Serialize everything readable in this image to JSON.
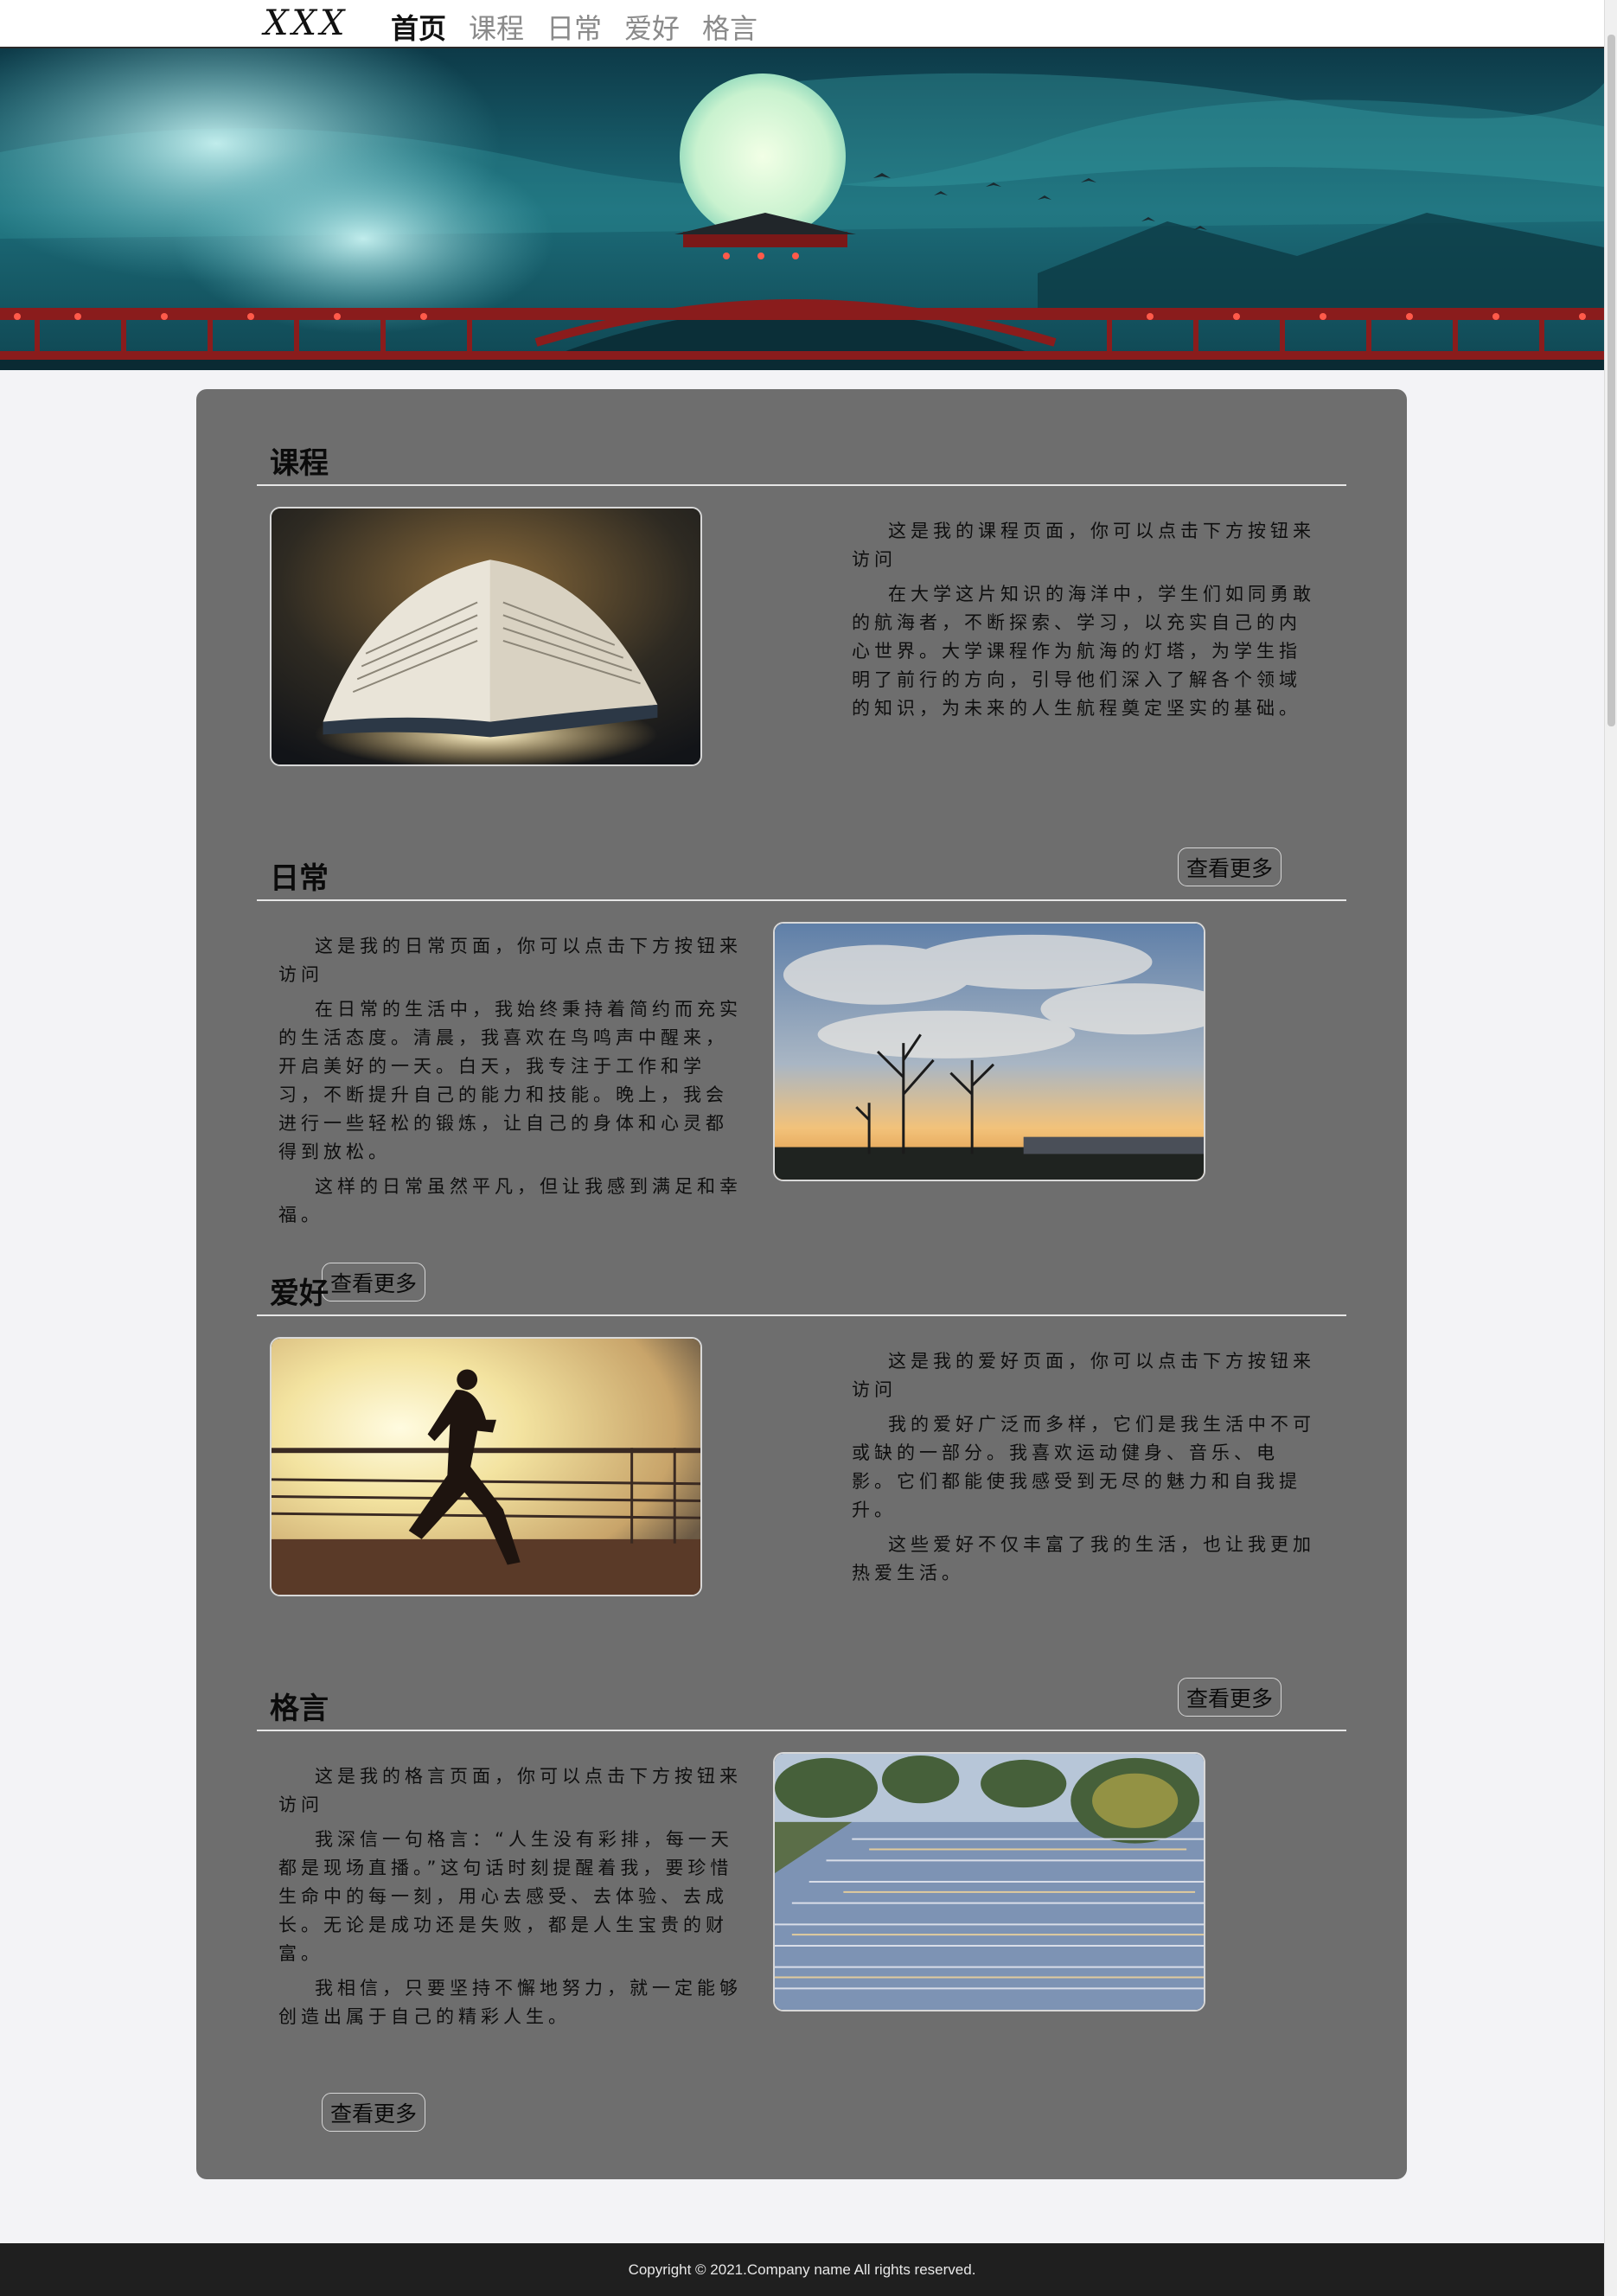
{
  "nav": {
    "logo": "XXX",
    "links": [
      "首页",
      "课程",
      "日常",
      "爱好",
      "格言"
    ],
    "active_index": 0
  },
  "sections": [
    {
      "title": "课程",
      "image": "open-book-photo",
      "paragraphs": [
        "这是我的课程页面，你可以点击下方按钮来访问",
        "在大学这片知识的海洋中，学生们如同勇敢的航海者，不断探索、学习，以充实自己的内心世界。大学课程作为航海的灯塔，为学生指明了前行的方向，引导他们深入了解各个领域的知识，为未来的人生航程奠定坚实的基础。"
      ],
      "button": "查看更多"
    },
    {
      "title": "日常",
      "image": "sunset-sky-photo",
      "paragraphs": [
        "这是我的日常页面，你可以点击下方按钮来访问",
        "在日常的生活中，我始终秉持着简约而充实的生活态度。清晨，我喜欢在鸟鸣声中醒来，开启美好的一天。白天，我专注于工作和学习，不断提升自己的能力和技能。晚上，我会进行一些轻松的锻炼，让自己的身体和心灵都得到放松。",
        "这样的日常虽然平凡，但让我感到满足和幸福。"
      ],
      "button": "查看更多"
    },
    {
      "title": "爱好",
      "image": "runner-sunrise-photo",
      "paragraphs": [
        "这是我的爱好页面，你可以点击下方按钮来访问",
        "我的爱好广泛而多样，它们是我生活中不可或缺的一部分。我喜欢运动健身、音乐、电影。它们都能使我感受到无尽的魅力和自我提升。",
        "这些爱好不仅丰富了我的生活，也让我更加热爱生活。"
      ],
      "button": "查看更多"
    },
    {
      "title": "格言",
      "image": "lit-stairs-photo",
      "paragraphs": [
        "这是我的格言页面，你可以点击下方按钮来访问",
        "我深信一句格言：“人生没有彩排，每一天都是现场直播。”这句话时刻提醒着我，要珍惜生命中的每一刻，用心去感受、去体验、去成长。无论是成功还是失败，都是人生宝贵的财富。",
        "我相信，只要坚持不懈地努力，就一定能够创造出属于自己的精彩人生。"
      ],
      "button": "查看更多"
    }
  ],
  "footer": {
    "copyright": "Copyright © 2021.Company name All rights reserved."
  },
  "colors": {
    "card_bg": "#6e6e6e",
    "page_bg": "#f3f3f6",
    "footer_bg": "#1f1f1f"
  }
}
